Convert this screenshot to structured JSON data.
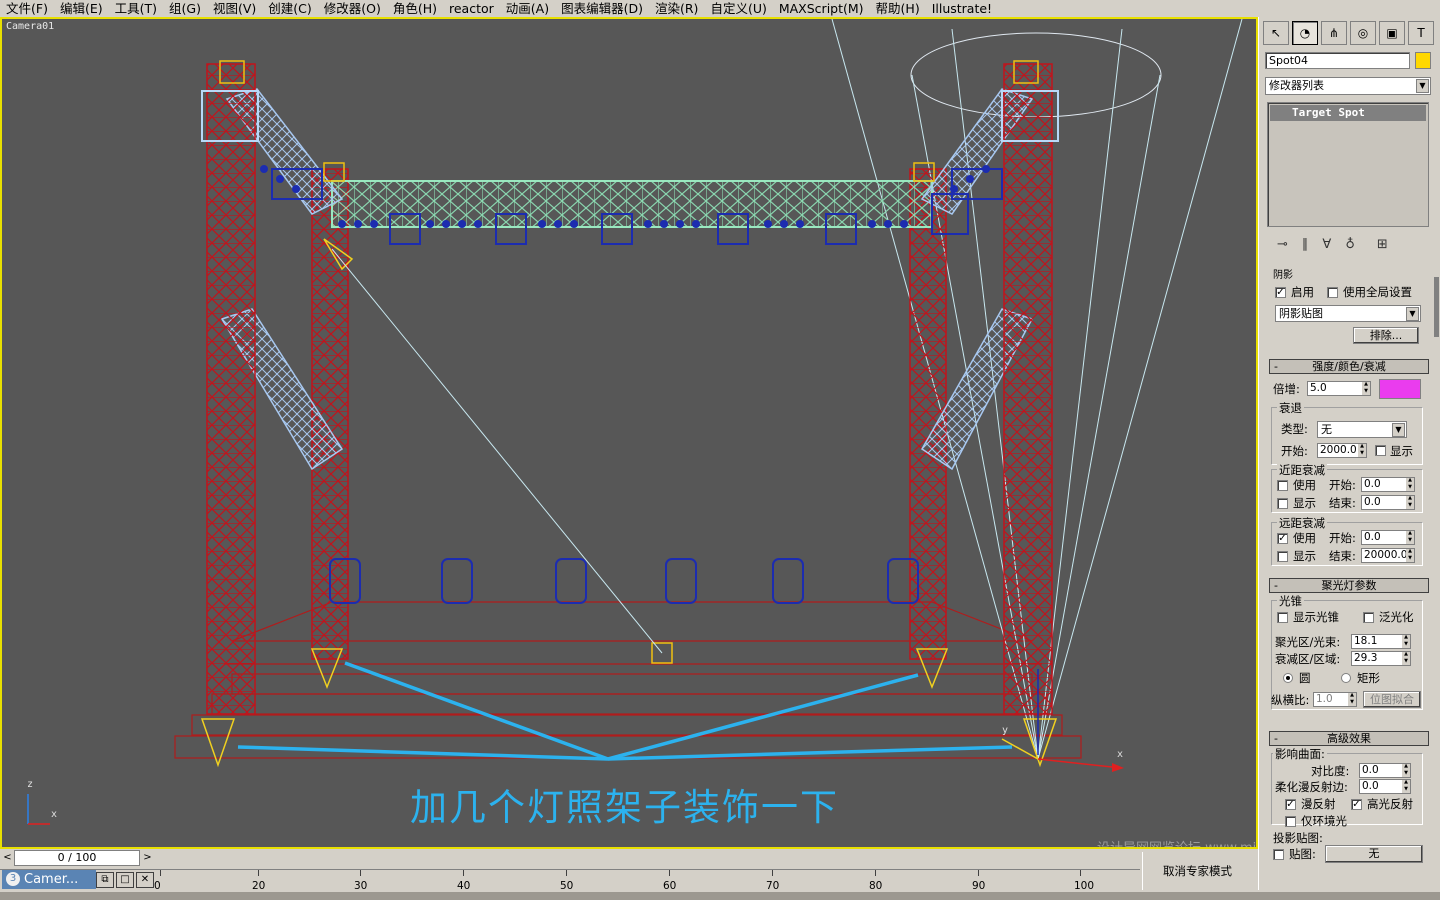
{
  "menu": [
    "文件(F)",
    "编辑(E)",
    "工具(T)",
    "组(G)",
    "视图(V)",
    "创建(C)",
    "修改器(O)",
    "角色(H)",
    "reactor",
    "动画(A)",
    "图表编辑器(D)",
    "渲染(R)",
    "自定义(U)",
    "MAXScript(M)",
    "帮助(H)",
    "Illustrate!"
  ],
  "viewport": {
    "label": "Camera01",
    "caption": "加几个灯照架子装饰一下",
    "watermark": "设计导网网览论坛 www.missyuan.net/forum",
    "gizmo": {
      "z": "z",
      "x": "x"
    },
    "axis": {
      "x": "x",
      "y": "y"
    }
  },
  "panel": {
    "tabs": [
      "select-icon",
      "modify-icon",
      "hierarchy-icon",
      "motion-icon",
      "display-icon",
      "utilities-icon"
    ],
    "object_name": "Spot04",
    "object_color": "#ffd800",
    "modifier_list": "修改器列表",
    "stack_item": "Target Spot",
    "shadow_section": "阴影",
    "shadow_on": "启用",
    "use_global": "使用全局设置",
    "shadow_type": "阴影贴图",
    "exclude_button": "排除...",
    "intensity_title": "强度/颜色/衰减",
    "multiplier_label": "倍增:",
    "multiplier_value": "5.0",
    "light_color": "#ea3cee",
    "decay_section": "衰退",
    "decay_type_label": "类型:",
    "decay_type_value": "无",
    "decay_start_label": "开始:",
    "decay_start_value": "2000.0",
    "decay_show": "显示",
    "near_section": "近距衰减",
    "near_use": "使用",
    "near_start_label": "开始:",
    "near_start_value": "0.0",
    "near_show": "显示",
    "near_end_label": "结束:",
    "near_end_value": "0.0",
    "far_section": "远距衰减",
    "far_use": "使用",
    "far_start_label": "开始:",
    "far_start_value": "0.0",
    "far_show": "显示",
    "far_end_label": "结束:",
    "far_end_value": "20000.0",
    "spot_title": "聚光灯参数",
    "cone_section": "光锥",
    "show_cone": "显示光锥",
    "overshoot": "泛光化",
    "hotspot_label": "聚光区/光束:",
    "hotspot_value": "18.1",
    "falloff_label": "衰减区/区域:",
    "falloff_value": "29.3",
    "circle": "圆",
    "rectangle": "矩形",
    "aspect_label": "纵横比:",
    "aspect_value": "1.0",
    "bitmap_fit": "位图拟合",
    "advanced_title": "高级效果",
    "affect_surfaces": "影响曲面:",
    "contrast_label": "对比度:",
    "contrast_value": "0.0",
    "soften_label": "柔化漫反射边:",
    "soften_value": "0.0",
    "diffuse": "漫反射",
    "specular": "高光反射",
    "ambient_only": "仅环境光",
    "projector_section": "投影贴图:",
    "map_label": "贴图:",
    "map_value": "无"
  },
  "timeline": {
    "frame_display": "0 / 100",
    "ticks": [
      "0",
      "20",
      "30",
      "40",
      "50",
      "60",
      "70",
      "80",
      "90",
      "100"
    ]
  },
  "status": {
    "task_label": "Camer...",
    "expert_mode": "取消专家模式"
  }
}
